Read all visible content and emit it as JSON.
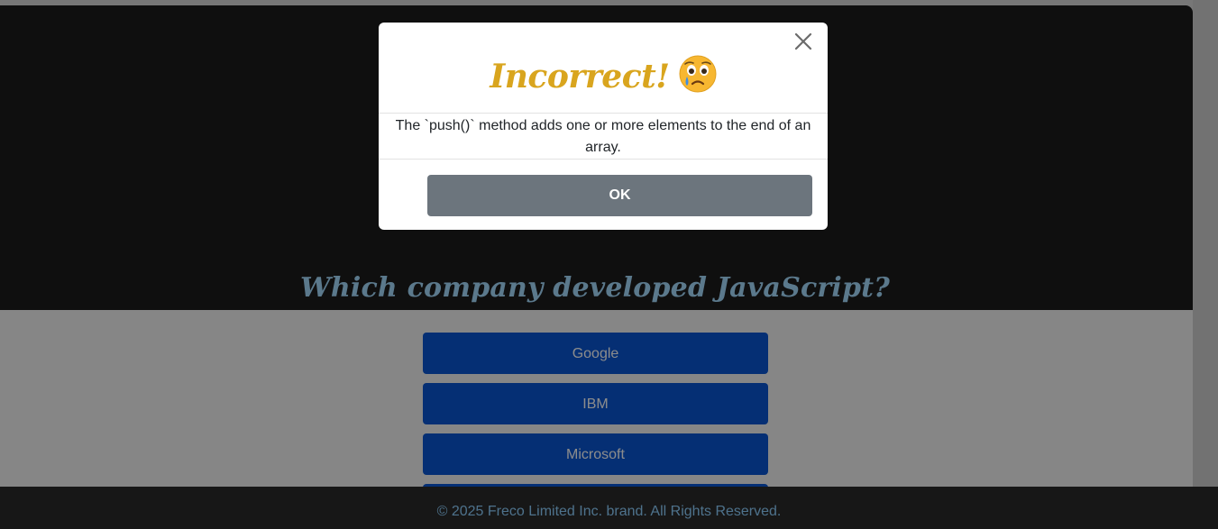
{
  "quiz": {
    "question": "Which company developed JavaScript?",
    "answers": [
      "Google",
      "IBM",
      "Microsoft"
    ]
  },
  "footer": {
    "text": "© 2025 Freco Limited Inc. brand. All Rights Reserved."
  },
  "modal": {
    "title": "Incorrect!",
    "title_icon": "sad-tear-face-icon",
    "message": "The `push()` method adds one or more elements to the end of an array.",
    "ok_label": "OK",
    "close_icon": "close-icon"
  },
  "colors": {
    "title": "#d9a51e",
    "question": "#a6dcff",
    "answer_button": "#0a56d3",
    "ok_button": "#6c757d",
    "footer_text": "#8ed0ff"
  }
}
